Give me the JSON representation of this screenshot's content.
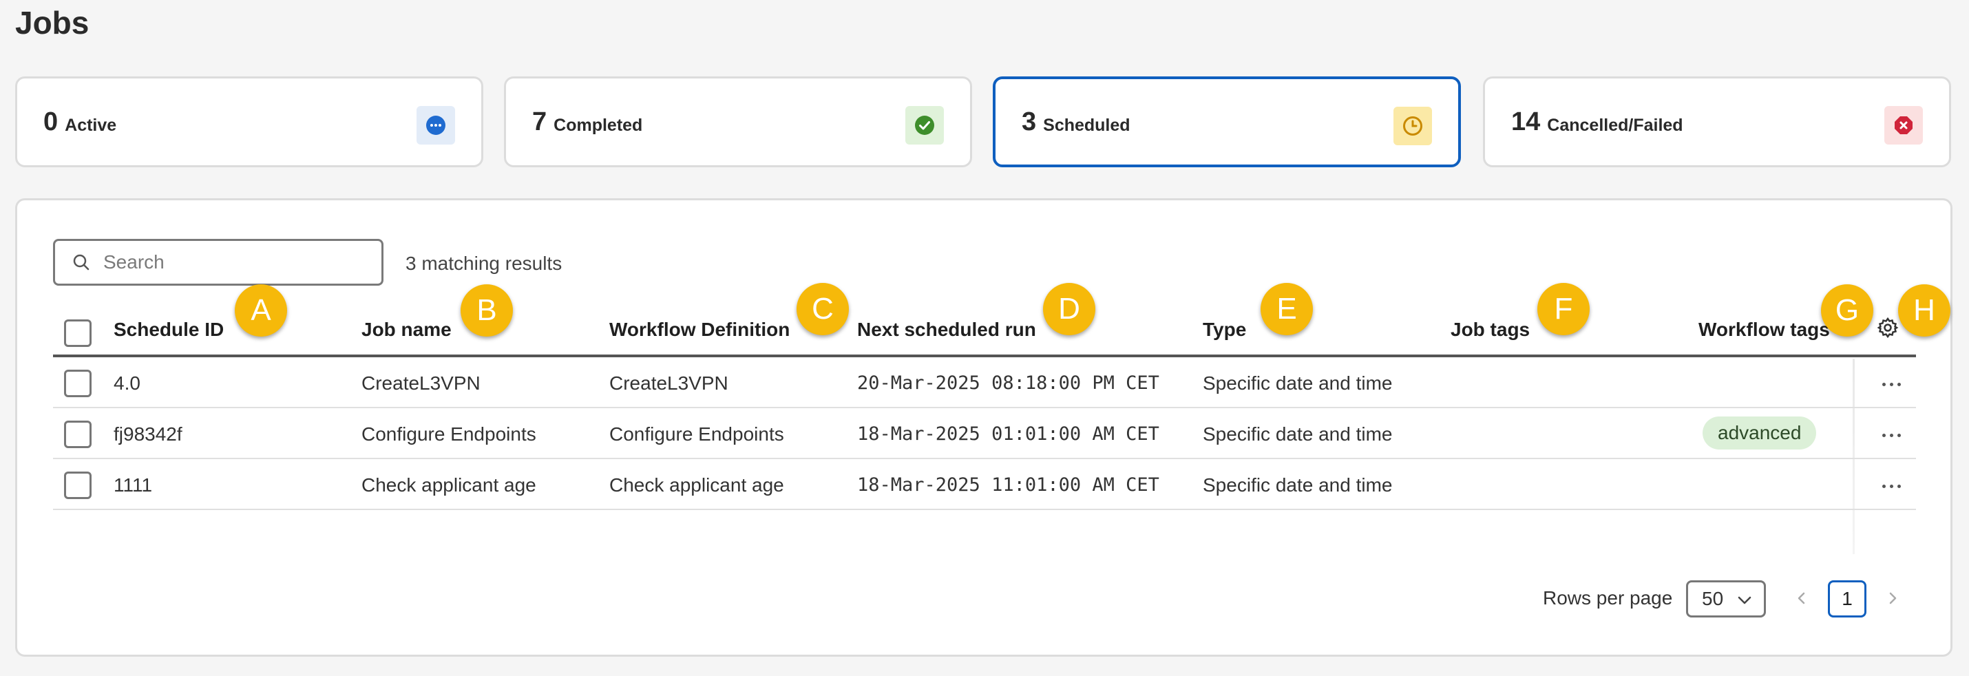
{
  "page": {
    "title": "Jobs"
  },
  "stats": [
    {
      "count": "0",
      "label": "Active",
      "icon": "dots-circle-icon",
      "icon_bg": "#e3ecf8",
      "icon_color": "#1f6bd0"
    },
    {
      "count": "7",
      "label": "Completed",
      "icon": "check-circle-icon",
      "icon_bg": "#e0f2da",
      "icon_color": "#3e8e2b"
    },
    {
      "count": "3",
      "label": "Scheduled",
      "icon": "clock-icon",
      "icon_bg": "#fbe9a6",
      "icon_color": "#c98a00"
    },
    {
      "count": "14",
      "label": "Cancelled/Failed",
      "icon": "x-circle-icon",
      "icon_bg": "#fbe0e0",
      "icon_color": "#d0243a"
    }
  ],
  "selected_stat": "Scheduled",
  "search": {
    "placeholder": "Search",
    "value": ""
  },
  "results_text": "3 matching results",
  "columns": {
    "schedule_id": "Schedule ID",
    "job_name": "Job name",
    "workflow_definition": "Workflow Definition",
    "next_run": "Next scheduled run",
    "type": "Type",
    "job_tags": "Job tags",
    "workflow_tags": "Workflow tags"
  },
  "rows": [
    {
      "schedule_id": "4.0",
      "job_name": "CreateL3VPN",
      "workflow_definition": "CreateL3VPN",
      "next_run": "20-Mar-2025 08:18:00 PM CET",
      "type": "Specific date and time",
      "job_tags": "",
      "workflow_tags": ""
    },
    {
      "schedule_id": "fj98342f",
      "job_name": "Configure Endpoints",
      "workflow_definition": "Configure Endpoints",
      "next_run": "18-Mar-2025 01:01:00 AM CET",
      "type": "Specific date and time",
      "job_tags": "",
      "workflow_tags": "advanced"
    },
    {
      "schedule_id": "1111",
      "job_name": "Check applicant age",
      "workflow_definition": "Check applicant age",
      "next_run": "18-Mar-2025 11:01:00 AM CET",
      "type": "Specific date and time",
      "job_tags": "",
      "workflow_tags": ""
    }
  ],
  "annotations": [
    "A",
    "B",
    "C",
    "D",
    "E",
    "F",
    "G",
    "H"
  ],
  "pagination": {
    "rows_per_page_label": "Rows per page",
    "rows_per_page": "50",
    "current_page": "1"
  },
  "colors": {
    "accent": "#0f5fbf",
    "annotation": "#f6b90a",
    "tag_bg": "#dcf0d8"
  }
}
